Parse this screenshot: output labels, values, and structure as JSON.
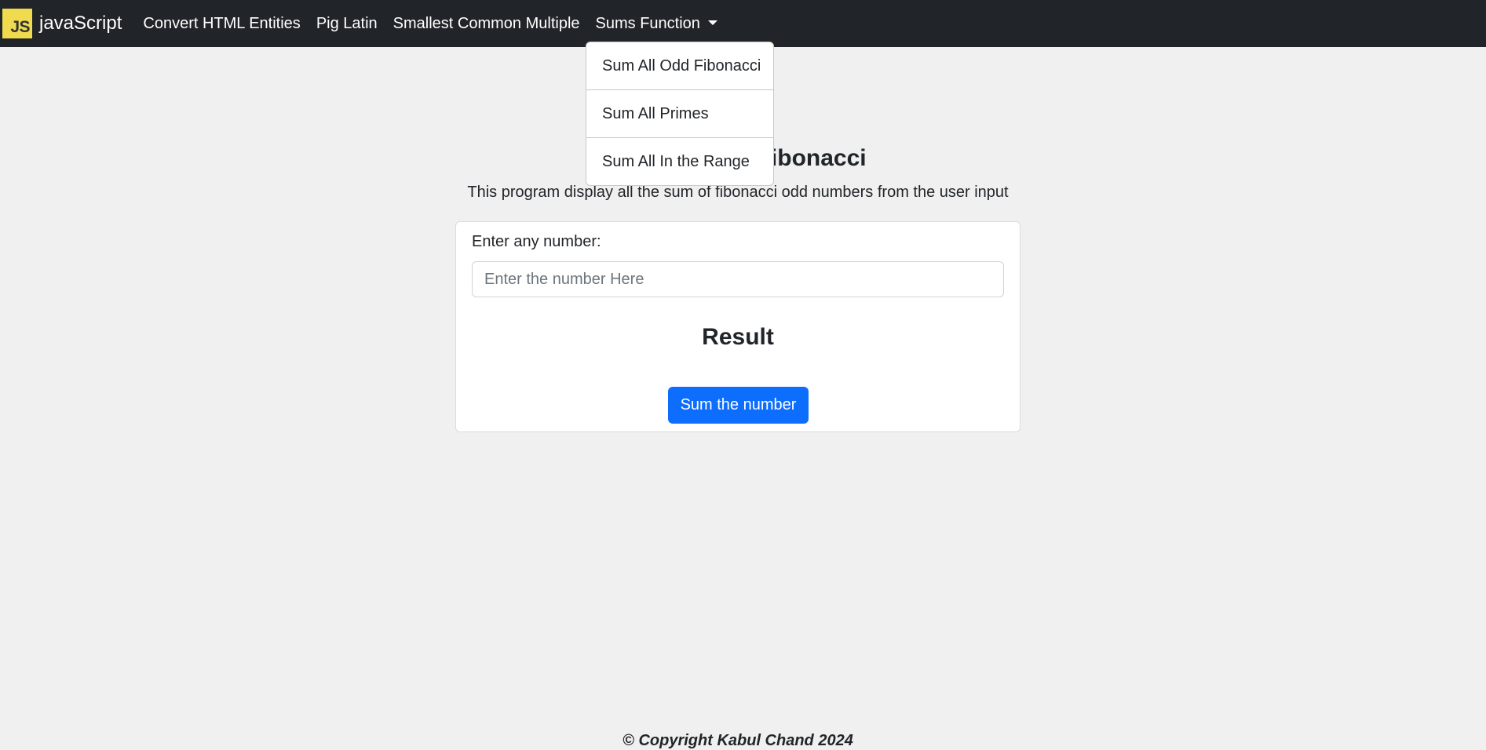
{
  "navbar": {
    "logo_text": "JS",
    "brand": "javaScript",
    "links": [
      {
        "label": "Convert HTML Entities"
      },
      {
        "label": "Pig Latin"
      },
      {
        "label": "Smallest Common Multiple"
      },
      {
        "label": "Sums Function"
      }
    ],
    "dropdown": {
      "items": [
        {
          "label": "Sum All Odd Fibonacci"
        },
        {
          "label": "Sum All Primes"
        },
        {
          "label": "Sum All In the Range"
        }
      ]
    }
  },
  "main": {
    "title": "Sum All Odd Fibonacci",
    "description": "This program display all the sum of fibonacci odd numbers from the user input",
    "input_label": "Enter any number:",
    "input_placeholder": "Enter the number Here",
    "input_value": "",
    "result_title": "Result",
    "button_label": "Sum the number"
  },
  "footer": {
    "text": "© Copyright Kabul Chand 2024"
  },
  "colors": {
    "navbar_bg": "#212529",
    "page_bg": "#f0f0f0",
    "primary_button": "#0d6efd",
    "js_logo": "#f0db4f"
  }
}
